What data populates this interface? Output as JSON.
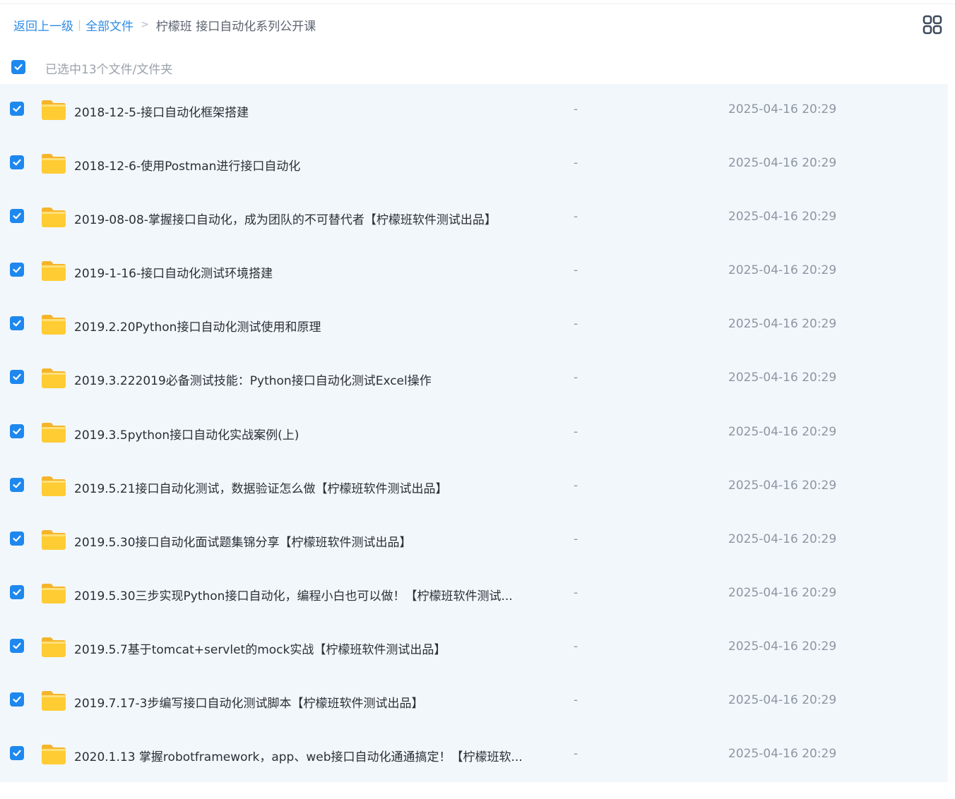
{
  "breadcrumb": {
    "back_label": "返回上一级",
    "separator": "|",
    "all_files_label": "全部文件",
    "arrow": ">",
    "current_folder": "柠檬班 接口自动化系列公开课"
  },
  "selection": {
    "status_text": "已选中13个文件/文件夹",
    "checked": true
  },
  "colors": {
    "accent": "#1e88ee",
    "link": "#2e8be6",
    "list_background": "#f2f7fc",
    "folder": "#ffc933"
  },
  "view_toggle": {
    "icon": "grid-view-icon"
  },
  "files": [
    {
      "name": "2018-12-5-接口自动化框架搭建",
      "size": "-",
      "modified": "2025-04-16 20:29",
      "icon": "folder-icon",
      "checked": true
    },
    {
      "name": "2018-12-6-使用Postman进行接口自动化",
      "size": "-",
      "modified": "2025-04-16 20:29",
      "icon": "folder-icon",
      "checked": true
    },
    {
      "name": "2019-08-08-掌握接口自动化，成为团队的不可替代者【柠檬班软件测试出品】",
      "size": "-",
      "modified": "2025-04-16 20:29",
      "icon": "folder-icon",
      "checked": true
    },
    {
      "name": "2019-1-16-接口自动化测试环境搭建",
      "size": "-",
      "modified": "2025-04-16 20:29",
      "icon": "folder-icon",
      "checked": true
    },
    {
      "name": "2019.2.20Python接口自动化测试使用和原理",
      "size": "-",
      "modified": "2025-04-16 20:29",
      "icon": "folder-icon",
      "checked": true
    },
    {
      "name": "2019.3.222019必备测试技能：Python接口自动化测试Excel操作",
      "size": "-",
      "modified": "2025-04-16 20:29",
      "icon": "folder-icon",
      "checked": true
    },
    {
      "name": "2019.3.5python接口自动化实战案例(上)",
      "size": "-",
      "modified": "2025-04-16 20:29",
      "icon": "folder-icon",
      "checked": true
    },
    {
      "name": "2019.5.21接口自动化测试，数据验证怎么做【柠檬班软件测试出品】",
      "size": "-",
      "modified": "2025-04-16 20:29",
      "icon": "folder-icon",
      "checked": true
    },
    {
      "name": "2019.5.30接口自动化面试题集锦分享【柠檬班软件测试出品】",
      "size": "-",
      "modified": "2025-04-16 20:29",
      "icon": "folder-icon",
      "checked": true
    },
    {
      "name": "2019.5.30三步实现Python接口自动化，编程小白也可以做！【柠檬班软件测试...",
      "size": "-",
      "modified": "2025-04-16 20:29",
      "icon": "folder-icon",
      "checked": true
    },
    {
      "name": "2019.5.7基于tomcat+servlet的mock实战【柠檬班软件测试出品】",
      "size": "-",
      "modified": "2025-04-16 20:29",
      "icon": "folder-icon",
      "checked": true
    },
    {
      "name": "2019.7.17-3步编写接口自动化测试脚本【柠檬班软件测试出品】",
      "size": "-",
      "modified": "2025-04-16 20:29",
      "icon": "folder-icon",
      "checked": true
    },
    {
      "name": "2020.1.13 掌握robotframework，app、web接口自动化通通搞定！【柠檬班软...",
      "size": "-",
      "modified": "2025-04-16 20:29",
      "icon": "folder-icon",
      "checked": true
    }
  ]
}
